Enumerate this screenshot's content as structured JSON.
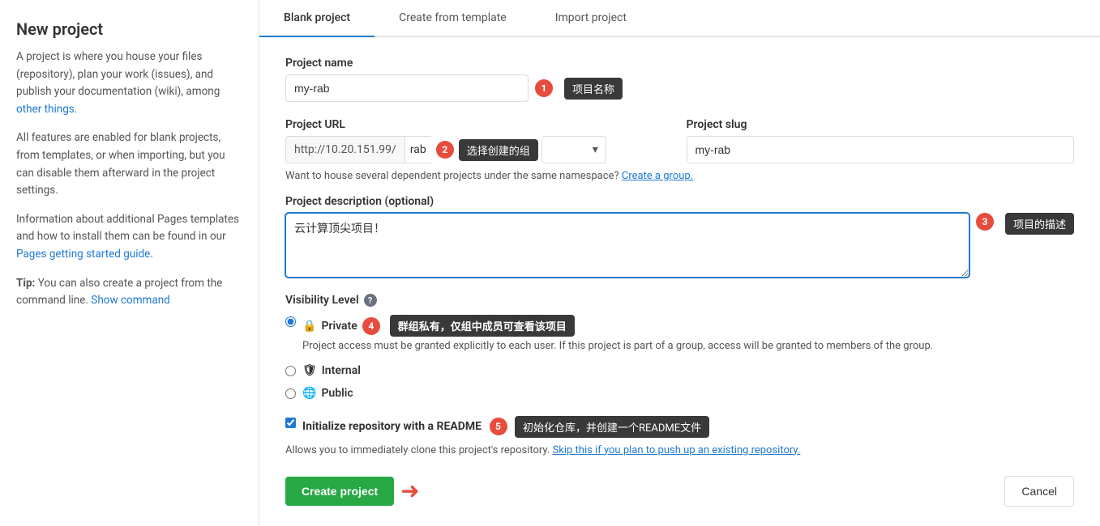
{
  "sidebar": {
    "title": "New project",
    "para1": "A project is where you house your files (repository), plan your work (issues), and publish your documentation (wiki), among other things.",
    "para1_link": "other things.",
    "para2": "All features are enabled for blank projects, from templates, or when importing, but you can disable them afterward in the project settings.",
    "para3_prefix": "Information about additional Pages templates and how to install them can be found in our ",
    "para3_link": "Pages getting started guide",
    "tip": "Tip: You can also create a project from the command line.",
    "show_command": "Show command"
  },
  "tabs": [
    {
      "label": "Blank project",
      "active": true
    },
    {
      "label": "Create from template",
      "active": false
    },
    {
      "label": "Import project",
      "active": false
    }
  ],
  "form": {
    "project_name_label": "Project name",
    "project_name_value": "my-rab",
    "project_name_tooltip": "项目名称",
    "project_url_label": "Project URL",
    "url_prefix": "http://10.20.151.99/",
    "url_rab": "rab",
    "namespace_tooltip": "选择创建的组",
    "namespace_placeholder": "选择创建的组",
    "project_slug_label": "Project slug",
    "project_slug_value": "my-rab",
    "group_help": "Want to house several dependent projects under the same namespace?",
    "group_link": "Create a group.",
    "description_label": "Project description (optional)",
    "description_value": "云计算顶尖项目！",
    "description_tooltip": "项目的描述",
    "visibility_label": "Visibility Level",
    "private_label": "Private",
    "private_tooltip": "群组私有，仅组中成员可查看该项目",
    "private_desc": "Project access must be granted explicitly to each user. If this project is part of a group, access will be granted to members of the group.",
    "internal_label": "Internal",
    "public_label": "Public",
    "init_repo_label": "Initialize repository with a README",
    "init_repo_tooltip": "初始化仓库，并创建一个README文件",
    "init_repo_desc_prefix": "Allows you to immediately clone this project's repository.",
    "init_repo_skip": "Skip this if you plan to push up an existing repository.",
    "create_button": "Create project",
    "cancel_button": "Cancel"
  }
}
